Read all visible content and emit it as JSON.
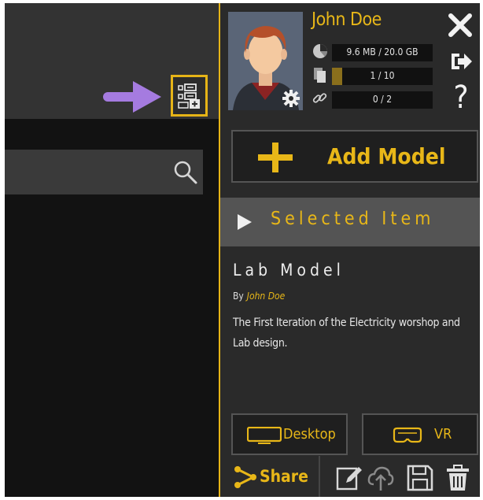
{
  "user": {
    "name": "John Doe",
    "storage": "9.6 MB / 20.0 GB",
    "models": "1 / 10",
    "links": "0 / 2",
    "models_fill_fraction": 0.1
  },
  "toolbar": {
    "add_model_label": "Add Model"
  },
  "selected": {
    "header": "Selected Item",
    "title": "Lab Model",
    "by_label": "By",
    "author": "John Doe",
    "description": "The First Iteration of the Electricity worshop and Lab design."
  },
  "actions": {
    "desktop_label": "Desktop",
    "vr_label": "VR",
    "share_label": "Share"
  },
  "icons": [
    "search-icon",
    "add-tool-icon",
    "pointer-arrow-icon",
    "settings-gear-icon",
    "storage-icon",
    "models-icon",
    "link-icon",
    "close-icon",
    "logout-icon",
    "help-icon",
    "plus-icon",
    "play-icon",
    "monitor-icon",
    "vr-headset-icon",
    "share-icon",
    "edit-icon",
    "upload-icon",
    "save-icon",
    "delete-icon"
  ],
  "colors": {
    "accent": "#e8b718",
    "highlight_border": "#e6b417",
    "arrow": "#a57be0",
    "panel": "#2a2a2a",
    "header": "#545454"
  }
}
